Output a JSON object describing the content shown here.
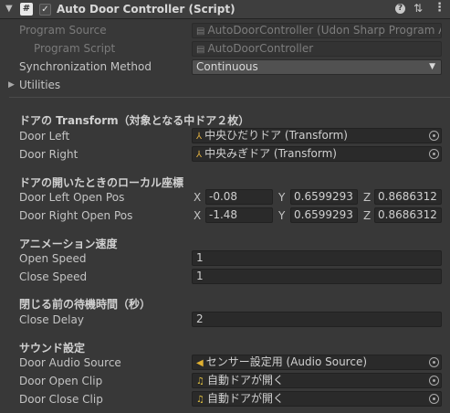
{
  "header": {
    "title": "Auto Door Controller (Script)",
    "checkbox": "✓",
    "script_icon": "#",
    "help_icon": "?",
    "preset_icon": "⇅",
    "menu_icon": "⋮",
    "enabled": true
  },
  "program_source": {
    "label": "Program Source",
    "value": "AutoDoorController (Udon Sharp Program A"
  },
  "program_script": {
    "label": "Program Script",
    "value": "AutoDoorController"
  },
  "sync": {
    "label": "Synchronization Method",
    "value": "Continuous"
  },
  "utilities": {
    "label": "Utilities"
  },
  "sections": {
    "transform": "ドアの Transform（対象となる中ドア２枚）",
    "local_pos": "ドアの開いたときのローカル座標",
    "anim_speed": "アニメーション速度",
    "wait_time": "閉じる前の待機時間（秒）",
    "sound": "サウンド設定"
  },
  "door_left": {
    "label": "Door Left",
    "value": "中央ひだりドア (Transform)"
  },
  "door_right": {
    "label": "Door Right",
    "value": "中央みぎドア (Transform)"
  },
  "axes": {
    "x": "X",
    "y": "Y",
    "z": "Z"
  },
  "door_left_open_pos": {
    "label": "Door Left Open Pos",
    "x": "-0.08",
    "y": "0.6599293",
    "z": "0.8686312"
  },
  "door_right_open_pos": {
    "label": "Door Right Open Pos",
    "x": "-1.48",
    "y": "0.6599293",
    "z": "0.8686312"
  },
  "open_speed": {
    "label": "Open Speed",
    "value": "1"
  },
  "close_speed": {
    "label": "Close Speed",
    "value": "1"
  },
  "close_delay": {
    "label": "Close Delay",
    "value": "2"
  },
  "door_audio_source": {
    "label": "Door Audio Source",
    "value": "センサー設定用 (Audio Source)"
  },
  "door_open_clip": {
    "label": "Door Open Clip",
    "value": "自動ドアが開く"
  },
  "door_close_clip": {
    "label": "Door Close Clip",
    "value": "自動ドアが開く"
  },
  "icons": {
    "script_asset": "▤",
    "transform": "⅄",
    "audio_source": "◀",
    "audio_clip": "♫",
    "dropdown": "▼",
    "collapse": "▼",
    "expand": "▶"
  }
}
